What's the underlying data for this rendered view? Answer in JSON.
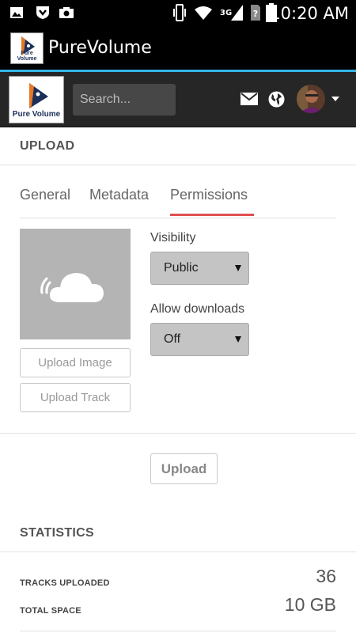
{
  "status_bar": {
    "time": "10:20 AM",
    "network": "3G",
    "icons": [
      "gallery-icon",
      "app-shield-icon",
      "camera-icon",
      "vibrate-icon",
      "wifi-icon",
      "signal-icon",
      "no-sim-icon",
      "battery-icon"
    ]
  },
  "app_bar": {
    "title": "PureVolume",
    "logo_text": "Pure Volume"
  },
  "header": {
    "logo_text": "Pure Volume",
    "search_placeholder": "Search...",
    "icons": [
      "mail-icon",
      "globe-icon",
      "avatar",
      "caret-down-icon"
    ]
  },
  "upload": {
    "title": "UPLOAD",
    "tabs": [
      {
        "label": "General",
        "active": false
      },
      {
        "label": "Metadata",
        "active": false
      },
      {
        "label": "Permissions",
        "active": true
      }
    ],
    "upload_image_label": "Upload Image",
    "upload_track_label": "Upload Track",
    "visibility_label": "Visibility",
    "visibility_value": "Public",
    "downloads_label": "Allow downloads",
    "downloads_value": "Off",
    "submit_label": "Upload"
  },
  "statistics": {
    "title": "STATISTICS",
    "rows": [
      {
        "label": "TRACKS UPLOADED",
        "value": "36"
      },
      {
        "label": "TOTAL SPACE",
        "value": "10 GB"
      }
    ]
  },
  "colors": {
    "accent_line": "#33b5e5",
    "active_tab_underline": "#e05050",
    "header_bg": "#262626",
    "artwork_bg": "#b4b4b4"
  }
}
